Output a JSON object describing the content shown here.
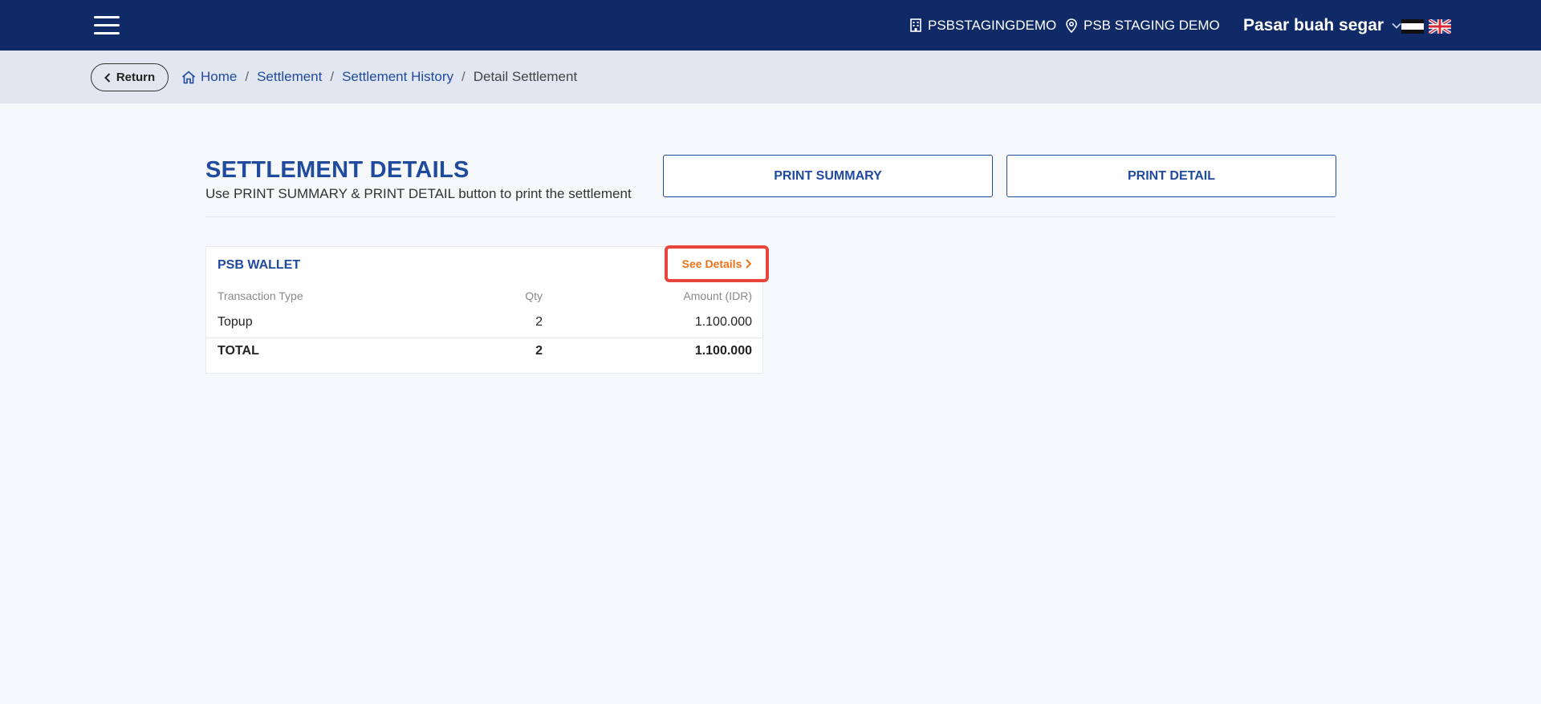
{
  "header": {
    "merchant_id": "PSBSTAGINGDEMO",
    "location": "PSB STAGING DEMO",
    "store_name": "Pasar buah segar",
    "colors": {
      "navbar": "#0f2a66",
      "primary": "#1f4a9e",
      "accent": "#e8731a",
      "highlight": "#e8453c"
    },
    "icons": [
      "menu-icon",
      "building-icon",
      "map-pin-icon",
      "chevron-down-icon",
      "flag-id-icon",
      "flag-en-icon"
    ]
  },
  "breadcrumb": {
    "return_label": "Return",
    "home": "Home",
    "settlement": "Settlement",
    "history": "Settlement History",
    "current": "Detail Settlement"
  },
  "main": {
    "title": "SETTLEMENT DETAILS",
    "subtitle": "Use PRINT SUMMARY & PRINT DETAIL button to print the settlement",
    "print_summary_label": "PRINT SUMMARY",
    "print_detail_label": "PRINT DETAIL"
  },
  "wallet_card": {
    "title": "PSB WALLET",
    "see_details_label": "See Details",
    "columns": [
      "Transaction Type",
      "Qty",
      "Amount (IDR)"
    ],
    "rows": [
      {
        "type": "Topup",
        "qty": "2",
        "amount": "1.100.000"
      }
    ],
    "total": {
      "label": "TOTAL",
      "qty": "2",
      "amount": "1.100.000"
    }
  }
}
